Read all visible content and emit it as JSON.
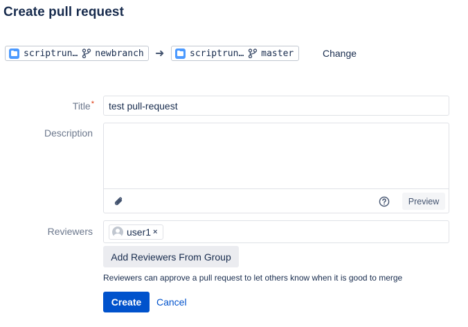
{
  "page": {
    "title": "Create pull request"
  },
  "branches": {
    "source": {
      "repo": "scriptrun…",
      "branch": "newbranch"
    },
    "arrow": "➜",
    "destination": {
      "repo": "scriptrun…",
      "branch": "master"
    },
    "change_label": "Change"
  },
  "form": {
    "title_label": "Title",
    "title_required_mark": "*",
    "title_value": "test pull-request",
    "description_label": "Description",
    "description_value": "",
    "preview_label": "Preview",
    "reviewers_label": "Reviewers",
    "reviewers": [
      {
        "name": "user1",
        "remove": "×"
      }
    ],
    "add_reviewers_group_label": "Add Reviewers From Group",
    "reviewers_help": "Reviewers can approve a pull request to let others know when it is good to merge"
  },
  "actions": {
    "create_label": "Create",
    "cancel_label": "Cancel"
  },
  "colors": {
    "primary": "#0052cc",
    "text": "#172b4d",
    "label": "#6b778c",
    "required": "#de350b",
    "repo_icon": "#4c9aff"
  },
  "icons": {
    "repo": "folder-icon",
    "branch": "branch-icon",
    "arrow": "arrow-right-icon",
    "attach": "paperclip-icon",
    "help": "help-circle-icon",
    "avatar": "user-avatar-icon",
    "remove": "close-icon"
  }
}
